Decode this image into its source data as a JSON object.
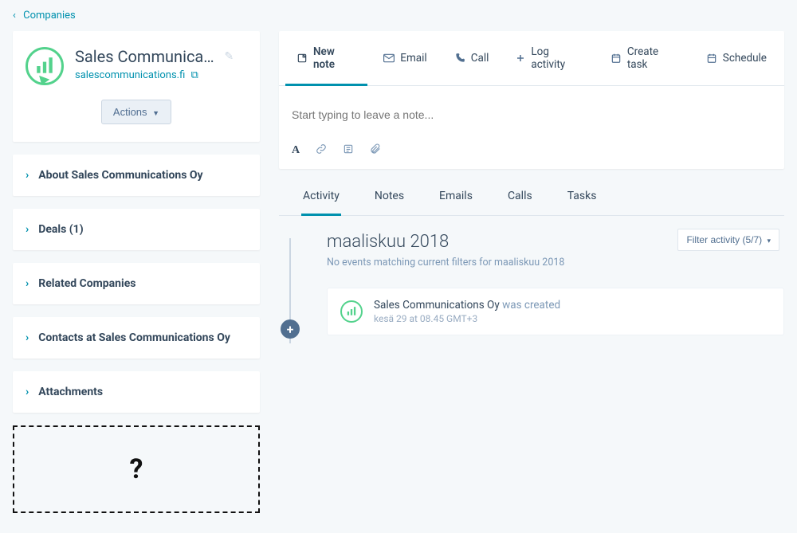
{
  "breadcrumb": {
    "label": "Companies"
  },
  "company": {
    "name": "Sales Communicati...",
    "domain": "salescommunications.fi",
    "actions_label": "Actions"
  },
  "sidebar_sections": [
    {
      "title": "About Sales Communications Oy"
    },
    {
      "title": "Deals (1)"
    },
    {
      "title": "Related Companies"
    },
    {
      "title": "Contacts at Sales Communications Oy"
    },
    {
      "title": "Attachments"
    }
  ],
  "mystery": "?",
  "compose_tabs": [
    {
      "label": "New note",
      "icon": "note",
      "active": true
    },
    {
      "label": "Email",
      "icon": "email"
    },
    {
      "label": "Call",
      "icon": "call"
    },
    {
      "label": "Log activity",
      "icon": "plus"
    },
    {
      "label": "Create task",
      "icon": "task"
    },
    {
      "label": "Schedule",
      "icon": "calendar"
    }
  ],
  "compose_placeholder": "Start typing to leave a note...",
  "activity_tabs": [
    {
      "label": "Activity",
      "active": true
    },
    {
      "label": "Notes"
    },
    {
      "label": "Emails"
    },
    {
      "label": "Calls"
    },
    {
      "label": "Tasks"
    }
  ],
  "filter_label": "Filter activity (5/7)",
  "timeline": {
    "month_label": "maaliskuu 2018",
    "no_events": "No events matching current filters for maaliskuu 2018",
    "event": {
      "subject": "Sales Communications Oy",
      "verb": "was created",
      "timestamp": "kesä 29 at 08.45 GMT+3"
    }
  }
}
